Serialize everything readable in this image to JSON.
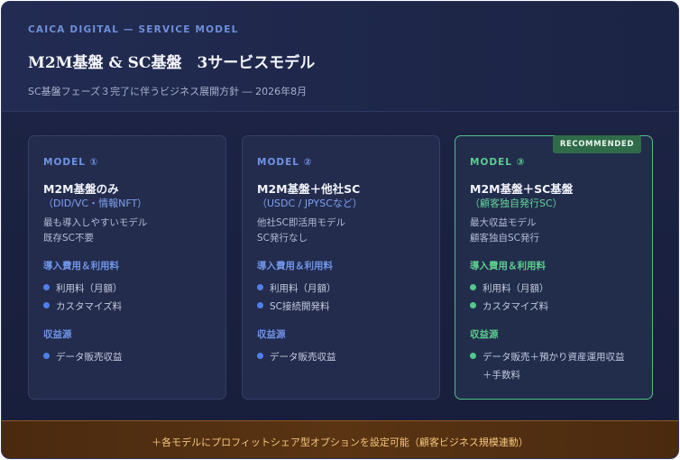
{
  "header": {
    "eyebrow": "CAICA DIGITAL — SERVICE MODEL",
    "title": "M2M基盤 & SC基盤　3サービスモデル",
    "subtitle": "SC基盤フェーズ３完了に伴うビジネス展開方針 ― 2026年8月"
  },
  "colors": {
    "background": "#1c2445",
    "accent_blue": "#6f93e6",
    "accent_green": "#5ccc8e",
    "footer_text": "#f3c57a"
  },
  "models": [
    {
      "model_label": "MODEL ①",
      "name": "M2M基盤のみ",
      "paren": "（DID/VC・情報NFT）",
      "desc": [
        "最も導入しやすいモデル",
        "既存SC不要"
      ],
      "fee_title": "導入費用＆利用料",
      "fees": [
        "利用料（月額）",
        "カスタマイズ料"
      ],
      "revenue_title": "収益源",
      "revenue": [
        "データ販売収益"
      ],
      "revenue_cont": ""
    },
    {
      "model_label": "MODEL ②",
      "name": "M2M基盤＋他社SC",
      "paren": "（USDC / JPYSCなど）",
      "desc": [
        "他社SC即活用モデル",
        "SC発行なし"
      ],
      "fee_title": "導入費用＆利用料",
      "fees": [
        "利用料（月額）",
        "SC接続開発料"
      ],
      "revenue_title": "収益源",
      "revenue": [
        "データ販売収益"
      ],
      "revenue_cont": ""
    },
    {
      "model_label": "MODEL ③",
      "name": "M2M基盤＋SC基盤",
      "paren": "（顧客独自発行SC）",
      "desc": [
        "最大収益モデル",
        "顧客独自SC発行"
      ],
      "fee_title": "導入費用＆利用料",
      "fees": [
        "利用料（月額）",
        "カスタマイズ料"
      ],
      "revenue_title": "収益源",
      "revenue": [
        "データ販売＋預かり資産運用収益"
      ],
      "revenue_cont": "＋手数料",
      "badge": "RECOMMENDED"
    }
  ],
  "footer": {
    "text": "＋各モデルにプロフィットシェア型オプションを設定可能（顧客ビジネス規模連動）"
  }
}
